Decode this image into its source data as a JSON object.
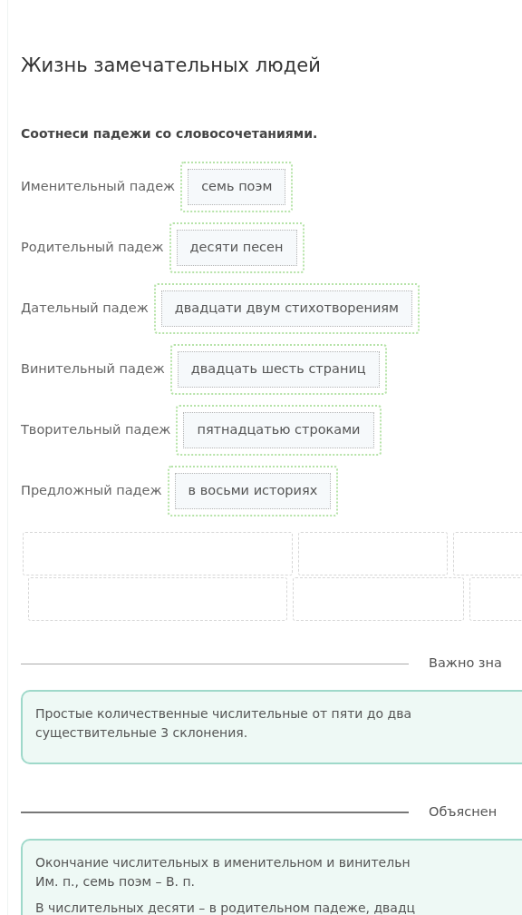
{
  "title": "Жизнь замечательных людей",
  "task": {
    "instruction": "Соотнеси падежи со словосочетаниями.",
    "pairs": [
      {
        "label": "Именительный падеж",
        "answer": "семь поэм"
      },
      {
        "label": "Родительный падеж",
        "answer": "десяти песен"
      },
      {
        "label": "Дательный падеж",
        "answer": "двадцати двум стихотворениям"
      },
      {
        "label": "Винительный падеж",
        "answer": "двадцать шесть страниц"
      },
      {
        "label": "Творительный падеж",
        "answer": "пятнадцатью строками"
      },
      {
        "label": "Предложный падеж",
        "answer": "в восьми историях"
      }
    ],
    "slot_rows": [
      {
        "slots": [
          {
            "kind": "empty"
          },
          {
            "kind": "empty"
          },
          {
            "kind": "empty"
          }
        ]
      },
      {
        "slots": [
          {
            "kind": "empty"
          },
          {
            "kind": "empty"
          },
          {
            "kind": "empty"
          }
        ]
      }
    ]
  },
  "sections": [
    {
      "heading": "Важно зна",
      "paragraphs": [
        [
          "Простые количественные числительные от пяти до два",
          "существительные 3 склонения."
        ]
      ]
    },
    {
      "heading": "Объяснен",
      "paragraphs": [
        [
          "Окончание числительных в именительном и винительн",
          "Им. п., семь поэм – В. п."
        ],
        [
          "В числительных десяти – в родительном падеже, двадц"
        ]
      ]
    }
  ]
}
